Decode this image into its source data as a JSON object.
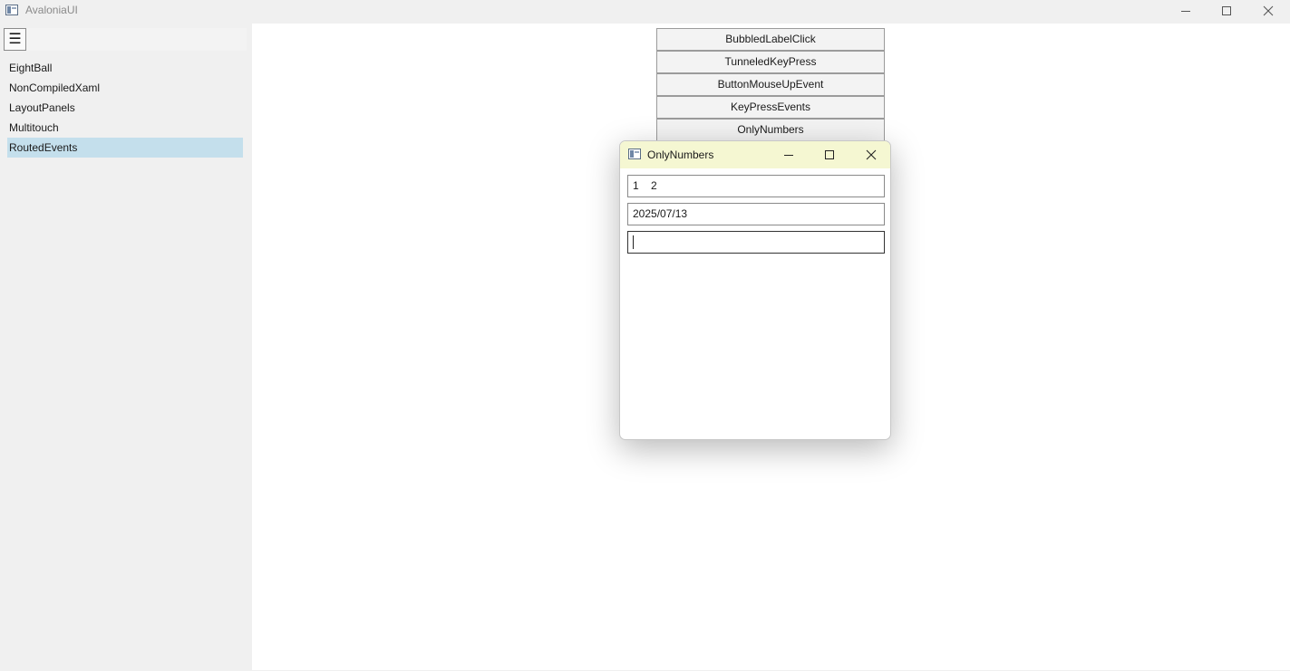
{
  "window": {
    "title": "AvaloniaUI"
  },
  "sidebar": {
    "menu_glyph": "☰",
    "items": [
      {
        "label": "EightBall"
      },
      {
        "label": "NonCompiledXaml"
      },
      {
        "label": "LayoutPanels"
      },
      {
        "label": "Multitouch"
      },
      {
        "label": "RoutedEvents",
        "selected": true
      }
    ]
  },
  "content": {
    "buttons": [
      {
        "label": "BubbledLabelClick"
      },
      {
        "label": "TunneledKeyPress"
      },
      {
        "label": "ButtonMouseUpEvent"
      },
      {
        "label": "KeyPressEvents"
      },
      {
        "label": "OnlyNumbers"
      }
    ]
  },
  "dialog": {
    "title": "OnlyNumbers",
    "fields": [
      {
        "value": "1    2"
      },
      {
        "value": "2025/07/13"
      },
      {
        "value": "",
        "focused": true
      }
    ]
  },
  "colors": {
    "selected_nav": "#c4dfec",
    "dialog_titlebar": "#f5f7d2"
  }
}
